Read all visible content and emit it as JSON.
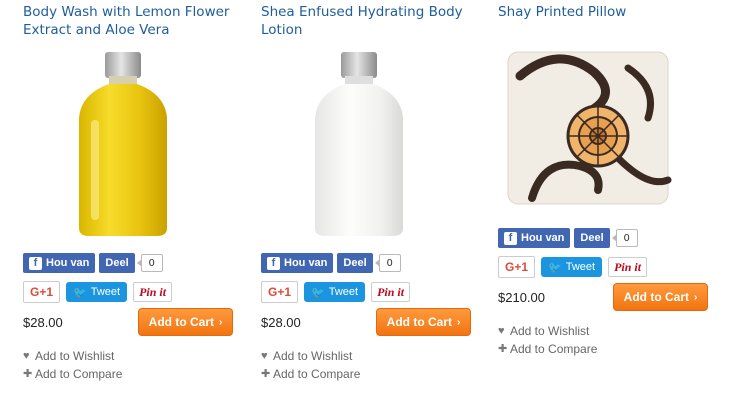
{
  "products": [
    {
      "title": "Body Wash with Lemon Flower Extract and Aloe Vera",
      "fb_like": "Hou van",
      "fb_share": "Deel",
      "fb_count": "0",
      "gplus": "G+1",
      "tweet": "Tweet",
      "pin": "Pin it",
      "price": "$28.00",
      "add_to_cart": "Add to Cart",
      "wishlist": "Add to Wishlist",
      "compare": "Add to Compare"
    },
    {
      "title": "Shea Enfused Hydrating Body Lotion",
      "fb_like": "Hou van",
      "fb_share": "Deel",
      "fb_count": "0",
      "gplus": "G+1",
      "tweet": "Tweet",
      "pin": "Pin it",
      "price": "$28.00",
      "add_to_cart": "Add to Cart",
      "wishlist": "Add to Wishlist",
      "compare": "Add to Compare"
    },
    {
      "title": "Shay Printed Pillow",
      "fb_like": "Hou van",
      "fb_share": "Deel",
      "fb_count": "0",
      "gplus": "G+1",
      "tweet": "Tweet",
      "pin": "Pin it",
      "price": "$210.00",
      "add_to_cart": "Add to Cart",
      "wishlist": "Add to Wishlist",
      "compare": "Add to Compare"
    }
  ],
  "colors": {
    "title_link": "#1f5d9b",
    "facebook": "#4267b2",
    "twitter": "#1b95e0",
    "pinterest": "#bd081c",
    "google_plus": "#dd4b39",
    "cart_button": "#f27411"
  }
}
